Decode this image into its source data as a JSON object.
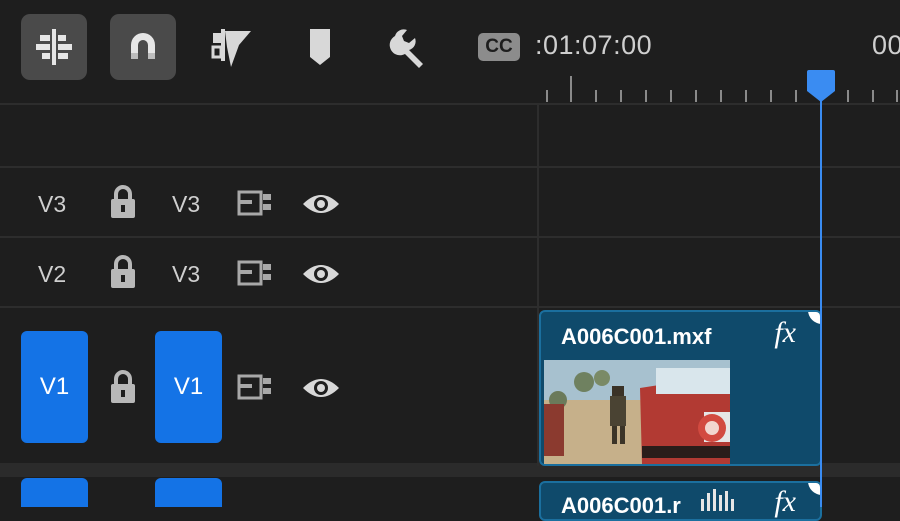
{
  "toolbar": {
    "tools": [
      {
        "name": "track-select-tool",
        "icon": "align-tracks-icon",
        "active": true
      },
      {
        "name": "snap-tool",
        "icon": "magnet-icon",
        "active": true
      },
      {
        "name": "linked-selection-tool",
        "icon": "linked-selection-icon",
        "active": false
      },
      {
        "name": "add-marker-tool",
        "icon": "marker-icon",
        "active": false
      },
      {
        "name": "settings-tool",
        "icon": "wrench-icon",
        "active": false
      },
      {
        "name": "captions-tool",
        "icon": "cc-icon",
        "active": false
      }
    ],
    "cc_label": "CC"
  },
  "ruler": {
    "timecode_left": ":01:07:00",
    "timecode_right": "00"
  },
  "tracks": [
    {
      "id": "V3",
      "source_label": "V3",
      "target_label": "V3",
      "lock": "lock-icon",
      "sync": "sync-icon",
      "eye": "eye-icon"
    },
    {
      "id": "V2",
      "source_label": "V2",
      "target_label": "V3",
      "lock": "lock-icon",
      "sync": "sync-icon",
      "eye": "eye-icon"
    },
    {
      "id": "V1",
      "source_label": "V1",
      "target_label": "V1",
      "lock": "lock-icon",
      "sync": "sync-icon",
      "eye": "eye-icon"
    }
  ],
  "clips": [
    {
      "name": "A006C001.mxf",
      "fx": "fx"
    },
    {
      "name": "A006C001.r",
      "fx": "fx"
    }
  ],
  "colors": {
    "background": "#1e1e1e",
    "accent": "#1473e6",
    "clip": "#0f4a6b",
    "playhead": "#3a8cf2"
  }
}
